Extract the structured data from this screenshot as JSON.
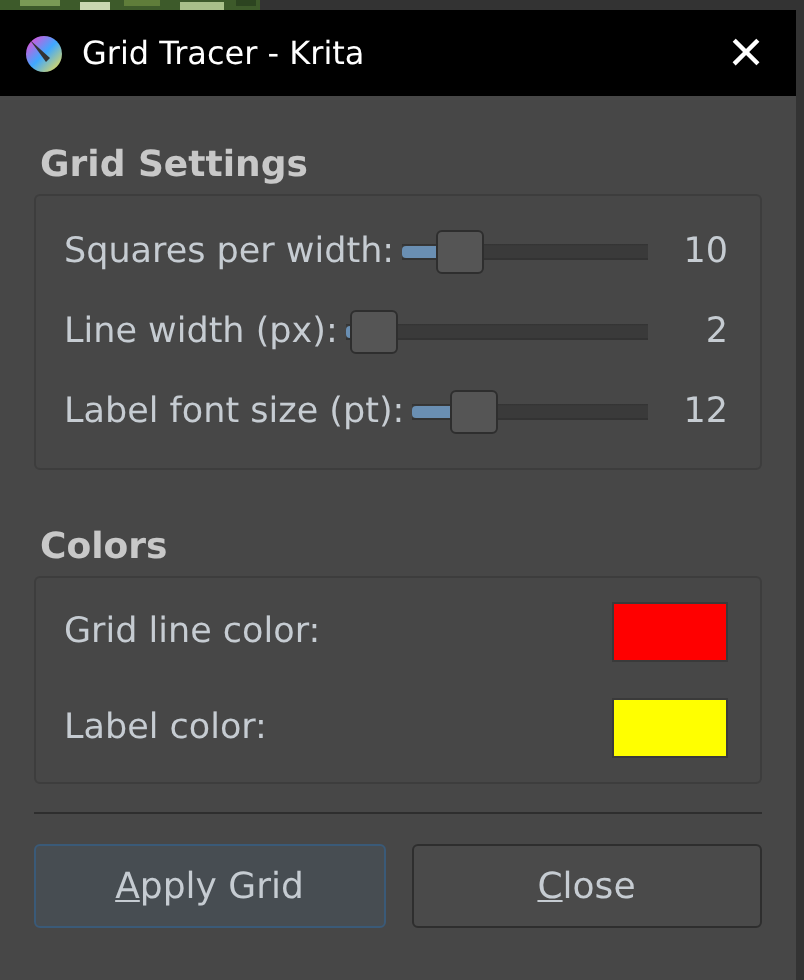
{
  "window": {
    "title": "Grid Tracer - Krita",
    "close": "×"
  },
  "grid_settings": {
    "heading": "Grid Settings",
    "sliders": [
      {
        "label": "Squares per width:",
        "level": 0.17,
        "reading": "10"
      },
      {
        "label": "Line width (px):",
        "level": 0.02,
        "reading": "2"
      },
      {
        "label": "Label font size (pt):",
        "level": 0.2,
        "reading": "12"
      }
    ]
  },
  "colors": {
    "heading": "Colors",
    "items": [
      {
        "label": "Grid line color:",
        "color": "#ff0000"
      },
      {
        "label": "Label color:",
        "color": "#ffff00"
      }
    ]
  },
  "buttons": [
    {
      "label": "Apply Grid",
      "kind": "default"
    },
    {
      "label": "Close",
      "kind": "normal"
    }
  ]
}
